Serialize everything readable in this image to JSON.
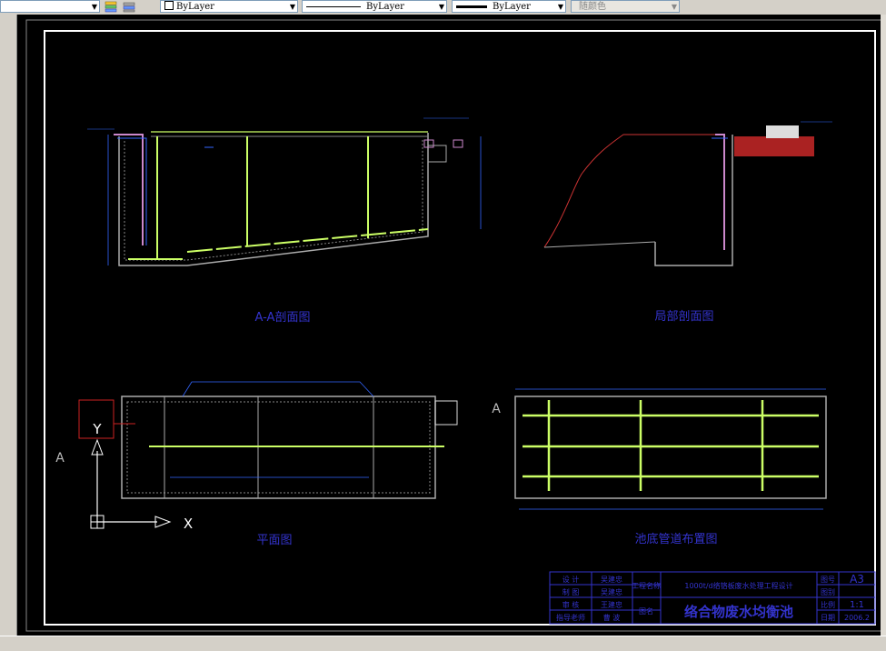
{
  "toolbar": {
    "layer_dd": "ByLayer",
    "linetype_dd": "ByLayer",
    "lineweight_dd": "ByLayer",
    "color_dd": "随颜色"
  },
  "drawing": {
    "view_aa_label": "A-A剖面图",
    "view_local_label": "局部剖面图",
    "view_plan_label": "平面图",
    "view_pipe_label": "池底管道布置图",
    "section_marker": "A",
    "ucs_x": "X",
    "ucs_y": "Y",
    "colors": {
      "frame": "#ffffff",
      "pipe": "#ccff66",
      "label": "#3333cc",
      "wall": "#aaaaaa",
      "red": "#cc2222",
      "dim": "#3366ff"
    }
  },
  "title_block": {
    "project": "1000t/d络铬板废水处理工程设计",
    "title": "络合物废水均衡池",
    "size": "A3",
    "scale": "1:1",
    "date": "2006.2",
    "rows": [
      {
        "role": "设  计",
        "name": "吴建忠"
      },
      {
        "role": "制  图",
        "name": "吴建忠"
      },
      {
        "role": "审  核",
        "name": "王建忠"
      },
      {
        "role": "指导老师",
        "name": "曹  波"
      }
    ],
    "project_label": "工程名称",
    "drawing_label": "图名",
    "fields": [
      "图号",
      "图别",
      "比例",
      "日期"
    ]
  }
}
